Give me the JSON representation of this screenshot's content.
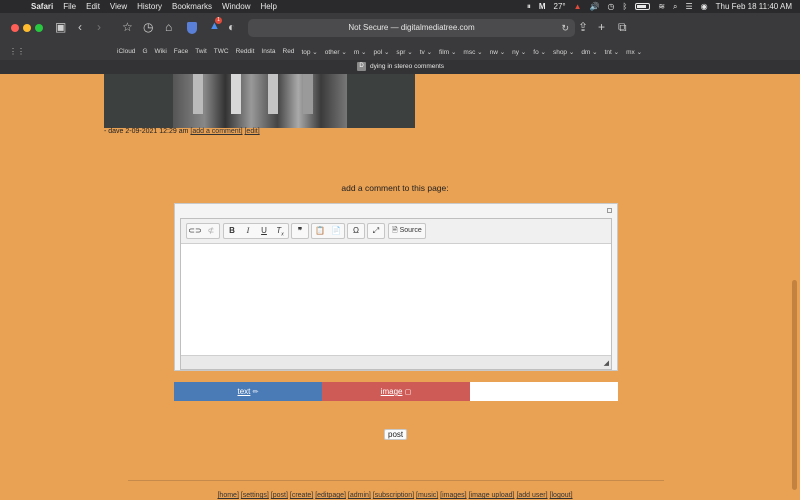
{
  "menubar": {
    "app": "Safari",
    "items": [
      "File",
      "Edit",
      "View",
      "History",
      "Bookmarks",
      "Window",
      "Help"
    ],
    "temperature": "27°",
    "datetime": "Thu Feb 18  11:40 AM"
  },
  "toolbar": {
    "url": "Not Secure — digitalmediatree.com",
    "badge": "1"
  },
  "favorites": [
    "iCloud",
    "G",
    "Wiki",
    "Face",
    "Twit",
    "TWC",
    "Reddit",
    "Insta",
    "Red",
    "top ⌄",
    "other ⌄",
    "m ⌄",
    "pol ⌄",
    "spr ⌄",
    "tv ⌄",
    "film ⌄",
    "msc ⌄",
    "nw ⌄",
    "ny ⌄",
    "fo ⌄",
    "shop ⌄",
    "dm ⌄",
    "tnt ⌄",
    "mx ⌄"
  ],
  "tab": {
    "favicon": "D",
    "title": "dying in stereo comments"
  },
  "post_meta": {
    "byline": "- dave 2-09-2021 12:29 am ",
    "add_comment": "[add a comment]",
    "edit": "[edit]"
  },
  "comment": {
    "heading": "add a comment to this page:"
  },
  "editor": {
    "source_label": "Source"
  },
  "mode_tabs": {
    "text": "text",
    "image": "image"
  },
  "post_button": "post",
  "footer": [
    "[home]",
    "[settings]",
    "[post]",
    "[create]",
    "[editpage]",
    "[admin]",
    "[subscription]",
    "[music]",
    "[images]",
    "[image upload]",
    "[add user]",
    "[logout]"
  ],
  "colors": {
    "page_bg": "#e9a154",
    "tab_text_bg": "#4b7bb7",
    "tab_image_bg": "#cf5b56"
  }
}
